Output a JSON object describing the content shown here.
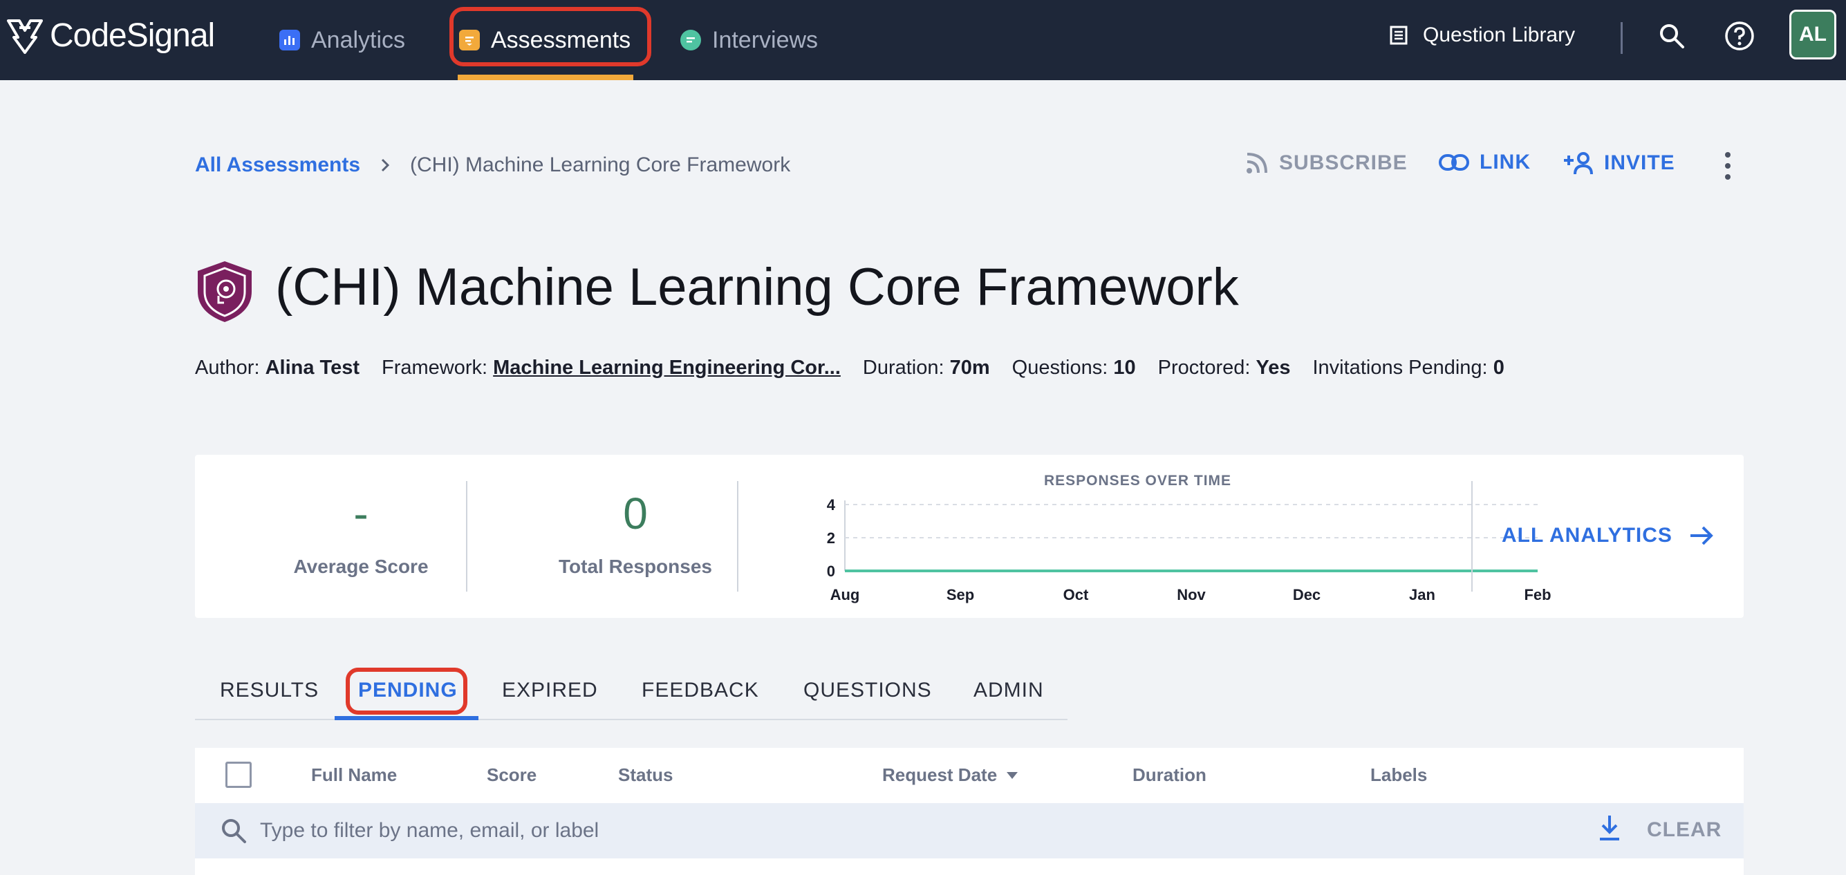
{
  "nav": {
    "logo_text": "CodeSignal",
    "items": [
      {
        "label": "Analytics",
        "icon": "bar-chart-icon",
        "color": "#3b6ff5"
      },
      {
        "label": "Assessments",
        "icon": "assessment-icon",
        "color": "#f2a93b"
      },
      {
        "label": "Interviews",
        "icon": "chat-bubble-icon",
        "color": "#4fc3a1"
      }
    ],
    "question_library": "Question Library",
    "avatar_initials": "AL",
    "active_accent": "#f2a93b",
    "highlight_color": "#e0392b"
  },
  "breadcrumb": {
    "root": "All Assessments",
    "current": "(CHI) Machine Learning Core Framework"
  },
  "actions": {
    "subscribe": "SUBSCRIBE",
    "link": "LINK",
    "invite": "INVITE"
  },
  "assessment": {
    "title": "(CHI) Machine Learning Core Framework",
    "meta": {
      "author_label": "Author:",
      "author": "Alina Test",
      "framework_label": "Framework:",
      "framework": "Machine Learning Engineering Cor...",
      "duration_label": "Duration:",
      "duration": "70m",
      "questions_label": "Questions:",
      "questions": "10",
      "proctored_label": "Proctored:",
      "proctored": "Yes",
      "invitations_label": "Invitations Pending:",
      "invitations": "0"
    }
  },
  "stats": {
    "average_score_value": "-",
    "average_score_label": "Average Score",
    "total_responses_value": "0",
    "total_responses_label": "Total Responses",
    "all_analytics": "ALL ANALYTICS"
  },
  "chart_data": {
    "type": "line",
    "title": "RESPONSES OVER TIME",
    "categories": [
      "Aug",
      "Sep",
      "Oct",
      "Nov",
      "Dec",
      "Jan",
      "Feb"
    ],
    "series": [
      {
        "values": [
          0,
          0,
          0,
          0,
          0,
          0,
          0
        ],
        "color": "#4fc3a1"
      }
    ],
    "y_ticks": [
      "4",
      "2",
      "0"
    ],
    "ylim": [
      0,
      4
    ],
    "grid": true
  },
  "tabs": {
    "items": [
      "RESULTS",
      "PENDING",
      "EXPIRED",
      "FEEDBACK",
      "QUESTIONS",
      "ADMIN"
    ],
    "active": "PENDING"
  },
  "table": {
    "columns": [
      "Full Name",
      "Score",
      "Status",
      "Request Date",
      "Duration",
      "Labels"
    ],
    "filter_placeholder": "Type to filter by name, email, or label",
    "clear_label": "CLEAR"
  }
}
